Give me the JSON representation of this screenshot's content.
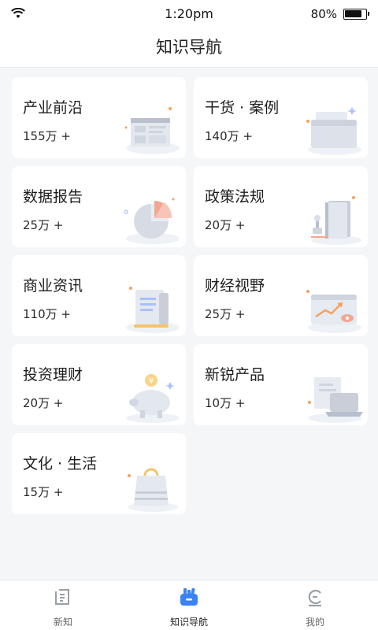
{
  "status_bar": {
    "time": "1:20pm",
    "battery": "80%",
    "icons": [
      "wifi-icon",
      "battery-icon"
    ]
  },
  "header": {
    "title": "知识导航"
  },
  "categories": [
    {
      "name": "产业前沿",
      "count": "155万 +",
      "icon": "browser-window-illustration"
    },
    {
      "name": "干货 · 案例",
      "count": "140万 +",
      "icon": "folder-documents-illustration"
    },
    {
      "name": "数据报告",
      "count": "25万 +",
      "icon": "pie-chart-illustration"
    },
    {
      "name": "政策法规",
      "count": "20万 +",
      "icon": "book-stamp-illustration"
    },
    {
      "name": "商业资讯",
      "count": "110万 +",
      "icon": "scroll-document-illustration"
    },
    {
      "name": "财经视野",
      "count": "25万 +",
      "icon": "trend-chart-illustration"
    },
    {
      "name": "投资理财",
      "count": "20万 +",
      "icon": "piggy-bank-illustration"
    },
    {
      "name": "新锐产品",
      "count": "10万 +",
      "icon": "laptop-illustration"
    },
    {
      "name": "文化 · 生活",
      "count": "15万 +",
      "icon": "shopping-bag-illustration"
    }
  ],
  "tab_bar": {
    "tabs": [
      {
        "label": "新知",
        "icon": "news-icon",
        "active": false
      },
      {
        "label": "知识导航",
        "icon": "books-icon",
        "active": true
      },
      {
        "label": "我的",
        "icon": "profile-icon",
        "active": false
      }
    ]
  },
  "colors": {
    "accent": "#3b82f6",
    "background": "#f5f6f8",
    "card": "#ffffff",
    "illustration_gray": "#c9ced8",
    "illustration_orange": "#f4a261"
  }
}
